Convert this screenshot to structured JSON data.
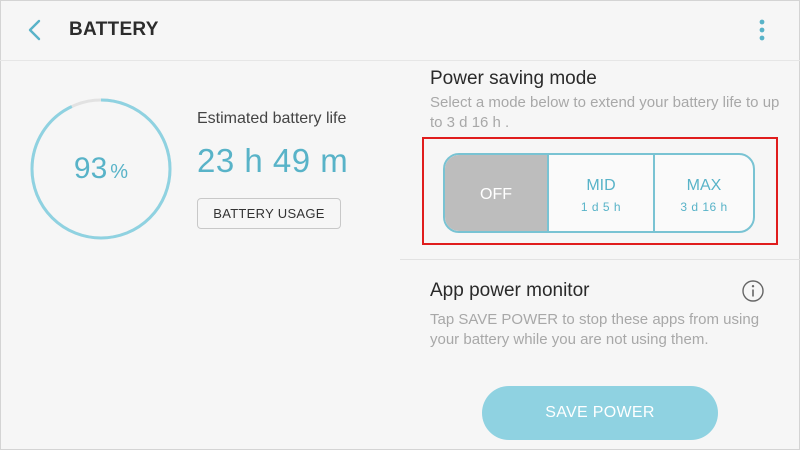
{
  "header": {
    "title": "BATTERY",
    "back_icon": "chevron-left-icon",
    "more_icon": "more-vert-icon"
  },
  "battery": {
    "percent_value": "93",
    "percent_symbol": "%",
    "level_fraction": 0.93,
    "estimated_label": "Estimated battery life",
    "estimated_value": "23 h 49 m",
    "usage_button": "BATTERY USAGE"
  },
  "power_saving": {
    "title": "Power saving mode",
    "description": "Select a mode below to extend your battery life to up to 3 d 16 h .",
    "selected": "OFF",
    "modes": [
      {
        "label": "OFF",
        "sub": ""
      },
      {
        "label": "MID",
        "sub": "1 d 5 h"
      },
      {
        "label": "MAX",
        "sub": "3 d 16 h"
      }
    ]
  },
  "app_power_monitor": {
    "title": "App power monitor",
    "info_icon": "info-icon",
    "description": "Tap SAVE POWER to stop these apps from using your battery while you are not using them.",
    "save_button": "SAVE POWER"
  },
  "colors": {
    "accent": "#58b3c8",
    "highlight_box": "#e01d1d",
    "save_button": "#8fd2e1",
    "off_selected": "#bdbdbd"
  }
}
